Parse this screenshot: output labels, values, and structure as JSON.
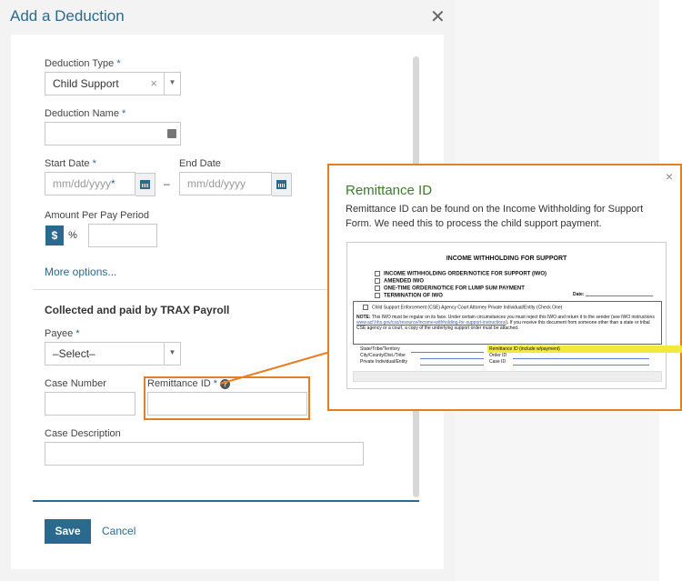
{
  "modal": {
    "title": "Add a Deduction",
    "close": "✕"
  },
  "form": {
    "deduction_type": {
      "label": "Deduction Type",
      "value": "Child Support",
      "required": "*"
    },
    "deduction_name": {
      "label": "Deduction Name",
      "value": "",
      "required": "*"
    },
    "start_date": {
      "label": "Start Date",
      "placeholder": "mm/dd/yyyy",
      "required": "*"
    },
    "end_date": {
      "label": "End Date",
      "placeholder": "mm/dd/yyyy"
    },
    "dash": "–",
    "amount": {
      "label": "Amount Per Pay Period",
      "dollar": "$",
      "percent": "%"
    },
    "more_options": "More options...",
    "section_title": "Collected and paid by TRAX Payroll",
    "payee": {
      "label": "Payee",
      "value": "–Select–",
      "required": "*"
    },
    "case_number": {
      "label": "Case Number"
    },
    "remittance_id": {
      "label": "Remittance ID",
      "required": "*",
      "help": "?"
    },
    "case_description": {
      "label": "Case Description"
    },
    "save": "Save",
    "cancel": "Cancel"
  },
  "popup": {
    "close": "×",
    "title": "Remittance ID",
    "body": "Remittance ID can be found on the Income Withholding for Support Form. We need this to process the child support payment."
  },
  "form_image": {
    "title": "INCOME WITHHOLDING FOR SUPPORT",
    "checks": [
      "INCOME WITHHOLDING ORDER/NOTICE FOR SUPPORT (IWO)",
      "AMENDED IWO",
      "ONE-TIME ORDER/NOTICE FOR LUMP SUM PAYMENT",
      "TERMINATION OF IWO"
    ],
    "date_label": "Date:",
    "agency_line": "Child Support Enforcement (CSE) Agency   Court   Attorney   Private Individual/Entity   (Check One)",
    "note_label": "NOTE:",
    "note_text": "This IWO must be regular on its face. Under certain circumstances you must reject this IWO and return it to the sender (see IWO instructions ",
    "note_link": "www.acf.hhs.gov/css/resource/income-withholding-for-support-instructions",
    "note_text2": "). If you receive this document from someone other than a state or tribal CSE agency or a court, a copy of the underlying support order must be attached.",
    "left_rows": [
      "State/Tribe/Territory",
      "City/County/Dist./Tribe",
      "Private Individual/Entity"
    ],
    "right_rows": [
      "Remittance ID (include w/payment)",
      "Order ID",
      "Case ID"
    ]
  }
}
